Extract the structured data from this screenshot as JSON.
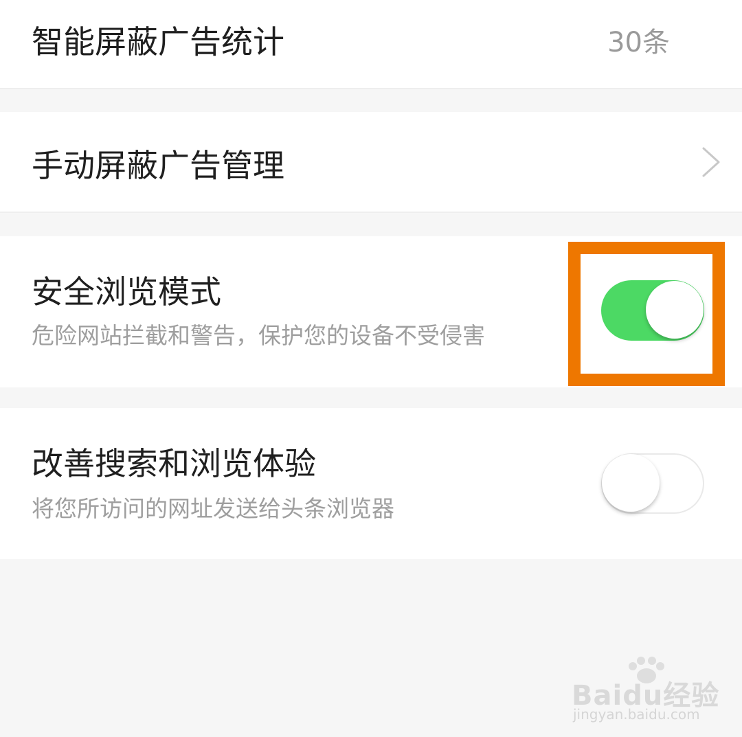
{
  "settings": {
    "ad_stats": {
      "label": "智能屏蔽广告统计",
      "value": "30条"
    },
    "manual_ads": {
      "label": "手动屏蔽广告管理"
    },
    "safe_browsing": {
      "label": "安全浏览模式",
      "description": "危险网站拦截和警告，保护您的设备不受侵害",
      "enabled": true
    },
    "improve_experience": {
      "label": "改善搜索和浏览体验",
      "description": "将您所访问的网址发送给头条浏览器",
      "enabled": false
    }
  },
  "icons": {
    "chevron": "chevron-right-icon",
    "watermark_paw": "paw-icon"
  },
  "watermark": {
    "brand": "Baidu经验",
    "url": "jingyan.baidu.com"
  },
  "colors": {
    "switch_on": "#4cd964",
    "highlight": "#ee7700"
  }
}
